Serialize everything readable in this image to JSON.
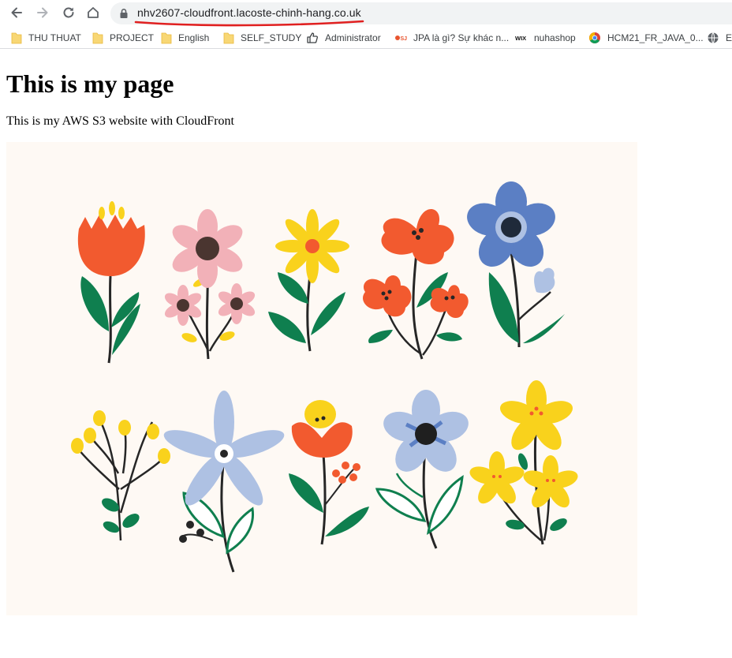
{
  "browser": {
    "url": "nhv2607-cloudfront.lacoste-chinh-hang.co.uk",
    "bookmarks": [
      {
        "label": "THU THUAT",
        "icon": "folder-icon"
      },
      {
        "label": "PROJECT",
        "icon": "folder-icon"
      },
      {
        "label": "English",
        "icon": "folder-icon"
      },
      {
        "label": "SELF_STUDY",
        "icon": "folder-icon"
      },
      {
        "label": "Administrator",
        "icon": "thumbs-up-icon"
      },
      {
        "label": "JPA là gì? Sự khác n...",
        "icon": "site-favicon-icon"
      },
      {
        "label": "nuhashop",
        "icon": "wix-icon"
      },
      {
        "label": "HCM21_FR_JAVA_0...",
        "icon": "chrome-icon"
      },
      {
        "label": "EI",
        "icon": "globe-icon"
      }
    ],
    "wix_logo_text": "WIX",
    "accent_color": "#1a73e8",
    "annotation_color": "#e02020"
  },
  "page": {
    "heading": "This is my page",
    "description": "This is my AWS S3 website with CloudFront",
    "image": {
      "subject": "flower-illustration",
      "background_color": "#fef9f4",
      "palette": [
        "#f25a2f",
        "#f9d21c",
        "#5b7fc4",
        "#aec1e3",
        "#f2b1b8",
        "#0f7f4f",
        "#262626"
      ]
    }
  }
}
